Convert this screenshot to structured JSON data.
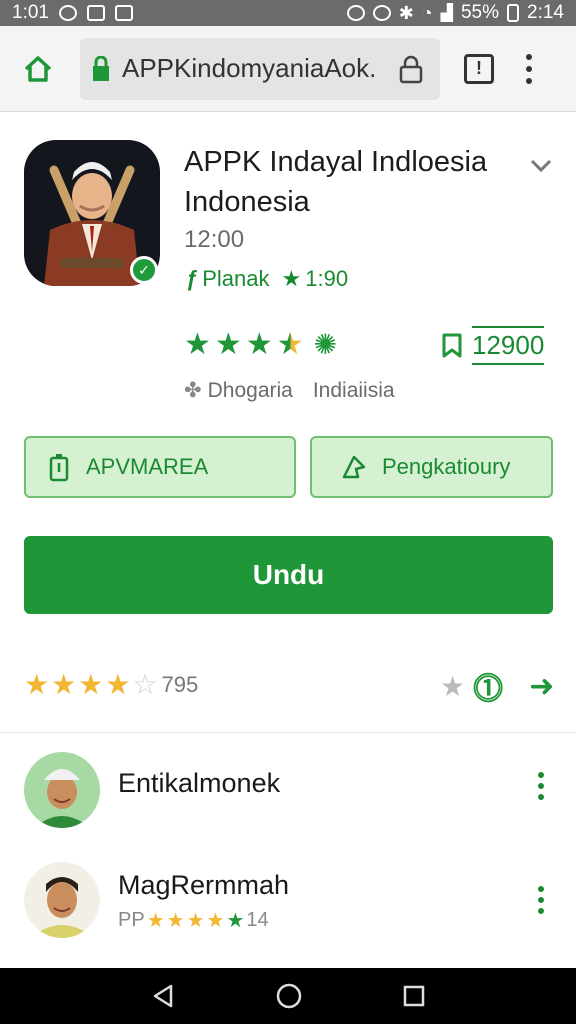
{
  "status_bar": {
    "time_left": "1:01",
    "battery": "55%",
    "time_right": "2:14"
  },
  "browser": {
    "url": "APPKindomyaniaAok.",
    "tab_count": "!"
  },
  "app": {
    "title_line1": "APPK Indayal Indloesia",
    "title_line2": "Indonesia",
    "version": "12:00",
    "rating_label": "Planak",
    "rating_value": "1:90",
    "downloads": "12900",
    "developer": "Dhogaria",
    "developer_region": "Indiaiisia",
    "accent_color": "#1f9638"
  },
  "actions": {
    "left_label": "APVMAREA",
    "right_label": "Pengkatioury",
    "primary_label": "Undu"
  },
  "ratings_summary": {
    "count": "795",
    "stars": 4
  },
  "reviews": [
    {
      "name": "Entikalmonek"
    },
    {
      "name": "MagRermmah",
      "meta_prefix": "PP",
      "meta_value": "14"
    }
  ]
}
